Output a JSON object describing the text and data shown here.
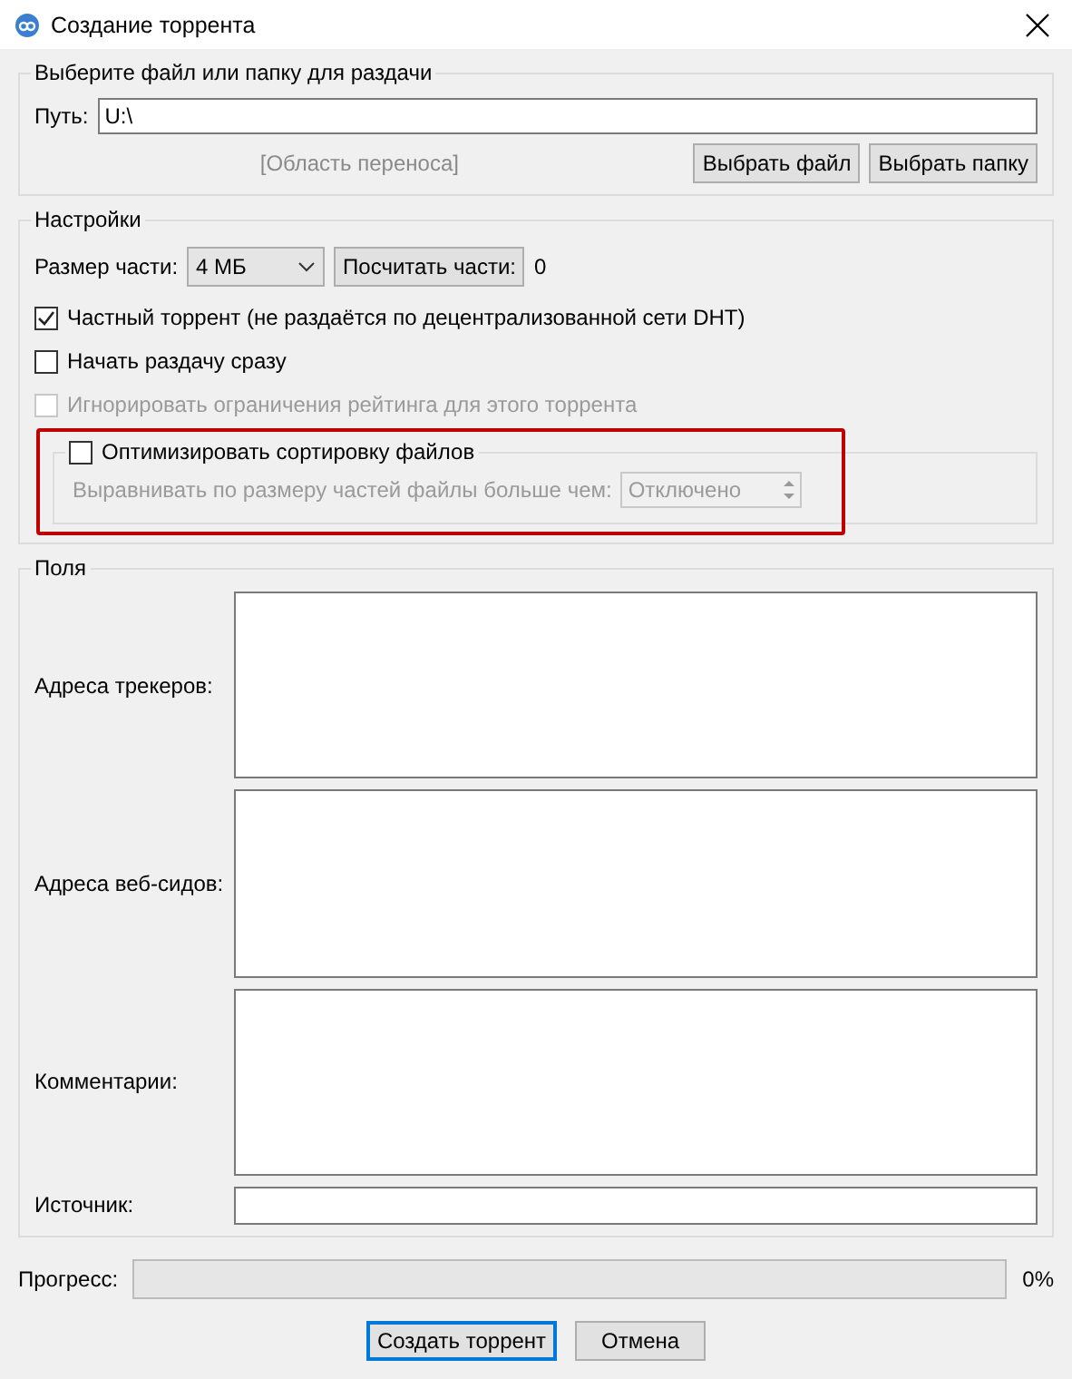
{
  "window": {
    "title": "Создание торрента"
  },
  "source_group": {
    "title": "Выберите файл или папку для раздачи",
    "path_label": "Путь:",
    "path_value": "U:\\",
    "drop_area": "[Область переноса]",
    "buttons": [
      "Выбрать файл",
      "Выбрать папку"
    ]
  },
  "settings": {
    "title": "Настройки",
    "piece_size_label": "Размер части:",
    "piece_size": "4 МБ",
    "calc_button": "Посчитать части:",
    "piece_count": "0",
    "options": [
      {
        "label": "Частный торрент (не раздаётся по децентрализованной сети DHT)",
        "checked": true,
        "disabled": false
      },
      {
        "label": "Начать раздачу сразу",
        "checked": false,
        "disabled": false
      },
      {
        "label": "Игнорировать ограничения рейтинга для этого торрента",
        "checked": false,
        "disabled": true
      }
    ],
    "optimize": {
      "label": "Оптимизировать сортировку файлов",
      "checked": false,
      "highlighted": true,
      "align_label": "Выравнивать по размеру частей файлы больше чем:",
      "align_value": "Отключено",
      "disabled": true
    }
  },
  "fields": {
    "title": "Поля",
    "rows": [
      {
        "label": "Адреса трекеров:",
        "kind": "multiline"
      },
      {
        "label": "Адреса веб-сидов:",
        "kind": "multiline"
      },
      {
        "label": "Комментарии:",
        "kind": "multiline"
      },
      {
        "label": "Источник:",
        "kind": "single"
      }
    ]
  },
  "progress": {
    "label": "Прогресс:",
    "level": 0,
    "reading": "0%"
  },
  "buttons": [
    {
      "label": "Создать торрент",
      "default": true
    },
    {
      "label": "Отмена",
      "default": false
    }
  ]
}
